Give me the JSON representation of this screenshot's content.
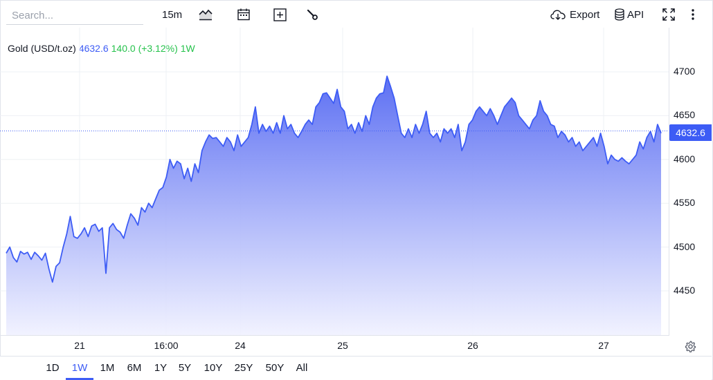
{
  "toolbar": {
    "search_placeholder": "Search...",
    "interval": "15m",
    "chart_type_icon": "area-chart-icon",
    "calendar_icon": "calendar-icon",
    "add_icon": "plus-square-icon",
    "settings_icon": "wrench-icon",
    "export_label": "Export",
    "api_label": "API",
    "fullscreen_icon": "fullscreen-icon",
    "more_icon": "more-vertical-icon"
  },
  "legend": {
    "symbol": "Gold (USD/t.oz)",
    "price": "4632.6",
    "change": "140.0 (+3.12%)",
    "timeframe": "1W"
  },
  "colors": {
    "accent": "#3d5cf5",
    "positive": "#26c24c",
    "line": "#3d5cf5",
    "fill_top": "#5468f2",
    "fill_bottom": "#f0f1ff"
  },
  "chart_data": {
    "type": "area",
    "title": "",
    "xlabel": "",
    "ylabel": "",
    "ylim": [
      4400,
      4725
    ],
    "y_ticks": [
      "4450",
      "4500",
      "4550",
      "4600",
      "4650",
      "4700"
    ],
    "last_price_label": "4632.6",
    "x_ticks": [
      "21",
      "16:00",
      "24",
      "25",
      "26",
      "27"
    ],
    "series": [
      {
        "values": [
          4493,
          4500,
          4488,
          4483,
          4495,
          4492,
          4494,
          4486,
          4494,
          4490,
          4485,
          4493,
          4475,
          4460,
          4478,
          4482,
          4500,
          4515,
          4535,
          4512,
          4510,
          4515,
          4522,
          4512,
          4524,
          4526,
          4518,
          4522,
          4470,
          4522,
          4527,
          4520,
          4517,
          4510,
          4525,
          4538,
          4533,
          4525,
          4545,
          4540,
          4550,
          4545,
          4555,
          4565,
          4568,
          4580,
          4600,
          4590,
          4598,
          4595,
          4578,
          4590,
          4575,
          4595,
          4585,
          4610,
          4620,
          4628,
          4624,
          4625,
          4620,
          4615,
          4625,
          4620,
          4610,
          4628,
          4615,
          4620,
          4625,
          4640,
          4660,
          4630,
          4640,
          4632,
          4638,
          4630,
          4642,
          4630,
          4650,
          4635,
          4640,
          4630,
          4625,
          4632,
          4640,
          4645,
          4640,
          4660,
          4665,
          4675,
          4676,
          4670,
          4664,
          4680,
          4660,
          4655,
          4635,
          4640,
          4630,
          4642,
          4632,
          4650,
          4640,
          4660,
          4670,
          4675,
          4676,
          4695,
          4683,
          4670,
          4650,
          4630,
          4625,
          4635,
          4625,
          4640,
          4630,
          4640,
          4655,
          4630,
          4625,
          4630,
          4620,
          4635,
          4630,
          4635,
          4625,
          4640,
          4610,
          4620,
          4640,
          4645,
          4655,
          4660,
          4655,
          4650,
          4658,
          4650,
          4640,
          4650,
          4660,
          4665,
          4670,
          4665,
          4650,
          4645,
          4640,
          4635,
          4645,
          4650,
          4667,
          4655,
          4650,
          4640,
          4638,
          4625,
          4632,
          4628,
          4620,
          4625,
          4615,
          4620,
          4610,
          4615,
          4620,
          4625,
          4615,
          4630,
          4615,
          4595,
          4605,
          4600,
          4598,
          4602,
          4598,
          4595,
          4600,
          4605,
          4620,
          4612,
          4625,
          4632,
          4620,
          4640,
          4630
        ]
      }
    ]
  },
  "ranges": [
    "1D",
    "1W",
    "1M",
    "6M",
    "1Y",
    "5Y",
    "10Y",
    "25Y",
    "50Y",
    "All"
  ],
  "active_range": "1W",
  "gear_icon": "gear-icon"
}
